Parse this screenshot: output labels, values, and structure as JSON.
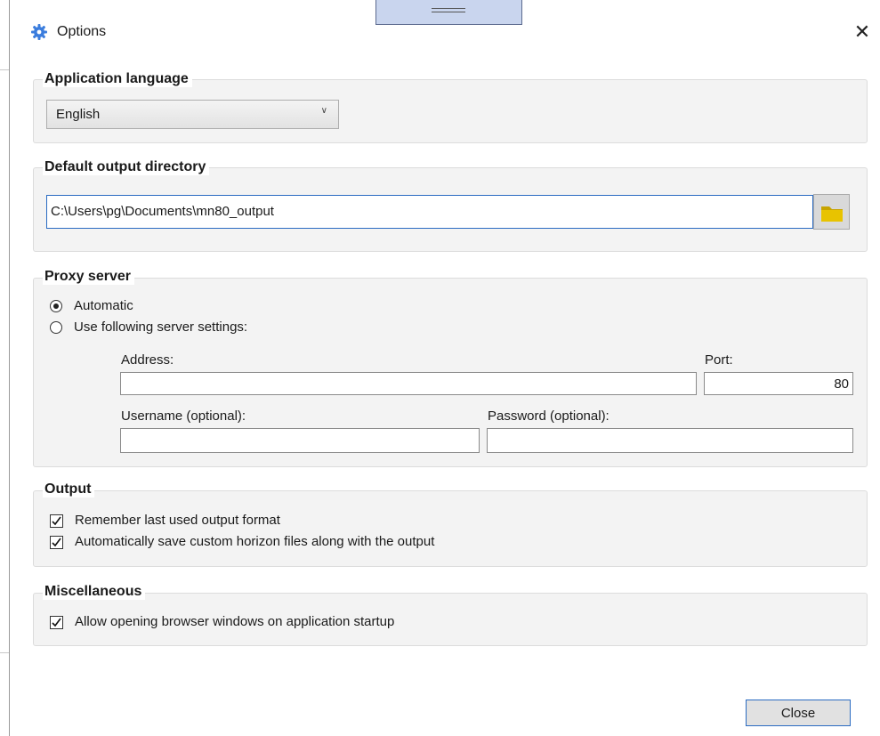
{
  "window": {
    "title": "Options",
    "title_icon": "gear-icon",
    "close_icon": "close-icon",
    "accent": "#2a6bc2"
  },
  "language": {
    "heading": "Application language",
    "selected": "English"
  },
  "output_dir": {
    "heading": "Default output directory",
    "value": "C:\\Users\\pg\\Documents\\mn80_output",
    "browse_icon": "folder-icon"
  },
  "proxy": {
    "heading": "Proxy server",
    "automatic_label": "Automatic",
    "manual_label": "Use following server settings:",
    "selected": "Automatic",
    "address_label": "Address:",
    "address_value": "",
    "port_label": "Port:",
    "port_value": "80",
    "username_label": "Username (optional):",
    "username_value": "",
    "password_label": "Password (optional):",
    "password_value": ""
  },
  "output": {
    "heading": "Output",
    "remember_format_label": "Remember last used output format",
    "remember_format_checked": true,
    "save_horizon_label": "Automatically save custom horizon files along with the output",
    "save_horizon_checked": true
  },
  "misc": {
    "heading": "Miscellaneous",
    "allow_browser_label": "Allow opening browser windows on application startup",
    "allow_browser_checked": true
  },
  "footer": {
    "close_label": "Close"
  }
}
